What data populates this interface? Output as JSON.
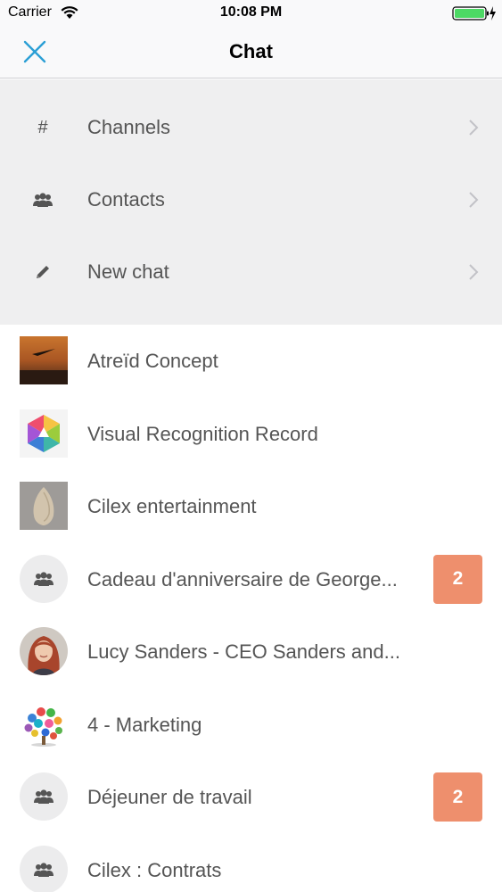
{
  "status_bar": {
    "carrier": "Carrier",
    "time": "10:08 PM"
  },
  "nav": {
    "title": "Chat",
    "close_icon": "close-x-icon",
    "accent_color": "#2b9fd5"
  },
  "menu": {
    "items": [
      {
        "label": "Channels",
        "icon": "hash-icon"
      },
      {
        "label": "Contacts",
        "icon": "group-icon"
      },
      {
        "label": "New chat",
        "icon": "pencil-icon"
      }
    ]
  },
  "chats": [
    {
      "name": "Atreïd Concept",
      "avatar": "sunset-bird-photo"
    },
    {
      "name": "Visual Recognition Record",
      "avatar": "colorful-hexagon-logo"
    },
    {
      "name": "Cilex entertainment",
      "avatar": "stone-arrowhead-photo"
    },
    {
      "name": "Cadeau d'anniversaire de George...",
      "avatar": "group-icon",
      "badge": "2"
    },
    {
      "name": "Lucy Sanders - CEO Sanders and...",
      "avatar": "person-photo"
    },
    {
      "name": "4 - Marketing",
      "avatar": "social-icons-tree-logo"
    },
    {
      "name": "Déjeuner de travail",
      "avatar": "group-icon",
      "badge": "2"
    },
    {
      "name": "Cilex : Contrats",
      "avatar": "group-icon"
    }
  ],
  "colors": {
    "badge": "#ee8f6d",
    "menu_background": "#efeff0",
    "battery": "#4cd964"
  }
}
